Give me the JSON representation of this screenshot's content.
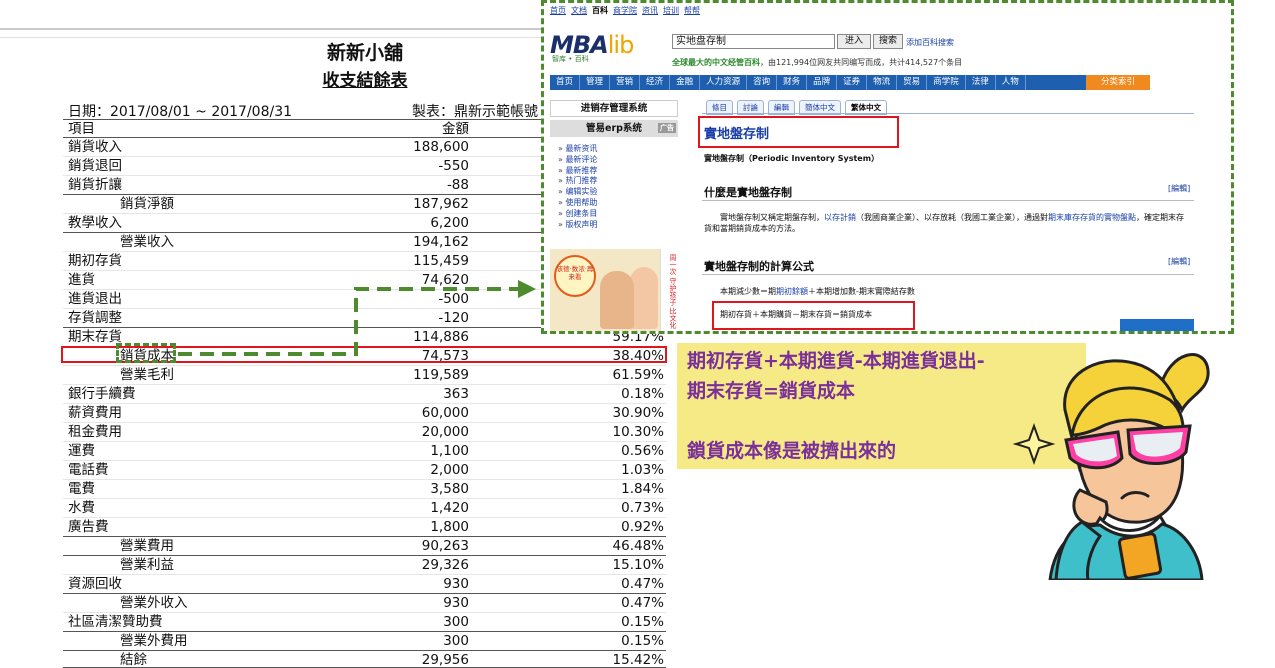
{
  "report": {
    "company": "新新小舖",
    "title": "收支結餘表",
    "date_range": "日期：2017/08/01 ~ 2017/08/31",
    "maker": "製表：鼎新示範帳號 ",
    "header": {
      "item": "項目",
      "amount": "金額",
      "pct": ""
    },
    "rows": [
      {
        "label": "銷貨收入",
        "amount": "188,600",
        "pct": "",
        "indent": false
      },
      {
        "label": "銷貨退回",
        "amount": "-550",
        "pct": "",
        "indent": false
      },
      {
        "label": "銷貨折讓",
        "amount": "-88",
        "pct": "",
        "indent": false
      },
      {
        "label": "銷貨淨額",
        "amount": "187,962",
        "pct": "",
        "indent": true
      },
      {
        "label": "教學收入",
        "amount": "6,200",
        "pct": "",
        "indent": false
      },
      {
        "label": "營業收入",
        "amount": "194,162",
        "pct": "",
        "indent": true
      },
      {
        "label": "期初存貨",
        "amount": "115,459",
        "pct": "",
        "indent": false
      },
      {
        "label": "進貨",
        "amount": "74,620",
        "pct": "",
        "indent": false
      },
      {
        "label": "進貨退出",
        "amount": "-500",
        "pct": "",
        "indent": false
      },
      {
        "label": "存貨調整",
        "amount": "-120",
        "pct": "",
        "indent": false
      },
      {
        "label": "期末存貨",
        "amount": "114,886",
        "pct": "59.17%",
        "indent": false
      },
      {
        "label": "銷貨成本",
        "amount": "74,573",
        "pct": "38.40%",
        "indent": true
      },
      {
        "label": "營業毛利",
        "amount": "119,589",
        "pct": "61.59%",
        "indent": true
      },
      {
        "label": "銀行手續費",
        "amount": "363",
        "pct": "0.18%",
        "indent": false
      },
      {
        "label": "薪資費用",
        "amount": "60,000",
        "pct": "30.90%",
        "indent": false
      },
      {
        "label": "租金費用",
        "amount": "20,000",
        "pct": "10.30%",
        "indent": false
      },
      {
        "label": "運費",
        "amount": "1,100",
        "pct": "0.56%",
        "indent": false
      },
      {
        "label": "電話費",
        "amount": "2,000",
        "pct": "1.03%",
        "indent": false
      },
      {
        "label": "電費",
        "amount": "3,580",
        "pct": "1.84%",
        "indent": false
      },
      {
        "label": "水費",
        "amount": "1,420",
        "pct": "0.73%",
        "indent": false
      },
      {
        "label": "廣告費",
        "amount": "1,800",
        "pct": "0.92%",
        "indent": false
      },
      {
        "label": "營業費用",
        "amount": "90,263",
        "pct": "46.48%",
        "indent": true
      },
      {
        "label": "營業利益",
        "amount": "29,326",
        "pct": "15.10%",
        "indent": true
      },
      {
        "label": "資源回收",
        "amount": "930",
        "pct": "0.47%",
        "indent": false
      },
      {
        "label": "營業外收入",
        "amount": "930",
        "pct": "0.47%",
        "indent": true
      },
      {
        "label": "社區清潔贊助費",
        "amount": "300",
        "pct": "0.15%",
        "indent": false
      },
      {
        "label": "營業外費用",
        "amount": "300",
        "pct": "0.15%",
        "indent": true
      },
      {
        "label": "結餘",
        "amount": "29,956",
        "pct": "15.42%",
        "indent": true
      }
    ]
  },
  "browser": {
    "topnav": [
      "首页",
      "文档",
      "百科",
      "商学院",
      "资讯",
      "培训",
      "帮帮"
    ],
    "topnav_current": "百科",
    "logo": {
      "main": "MBA",
      "accent": "lib",
      "sub": "智库 • 百科"
    },
    "search_value": "实地盘存制",
    "search_btn_in": "进入",
    "search_btn_search": "搜索",
    "add_link": "添加百科搜索",
    "slogan_prefix": "全球最大的中文经管百科",
    "slogan_rest": "，由121,994位网友共同编写而成，共计414,527个条目",
    "menu": [
      "首页",
      "管理",
      "营销",
      "经济",
      "金融",
      "人力资源",
      "咨询",
      "财务",
      "品牌",
      "证券",
      "物流",
      "贸易",
      "商学院",
      "法律",
      "人物"
    ],
    "menu_special": "分类索引",
    "side_box1": "进销存管理系统",
    "side_box2": "管易erp系统",
    "ad_tag": "广告",
    "side_links": [
      "最新资讯",
      "最新评论",
      "最新推荐",
      "热门推荐",
      "编辑实验",
      "使用帮助",
      "创建条目",
      "版权声明"
    ],
    "ad_text": "该德·数浓·再来看",
    "ad_strip": "周一次 守护孩子 比文化",
    "tabs": [
      "條目",
      "討論",
      "編輯",
      "簡体中文",
      "繁体中文"
    ],
    "tab_current": "繁体中文",
    "article_title": "實地盤存制",
    "article_en": "實地盤存制（Periodic Inventory System）",
    "section1": "什麼是實地盤存制",
    "edit_label": "[編輯]",
    "para_a": "　　實地盤存制又稱定期盤存制，",
    "para_link1": "以存計銷",
    "para_b": "（我國商業企業）、以存放耗（我國工業企業），通過對",
    "para_link2": "期末庫存存貨的實物盤點",
    "para_c": "，確定期末存貨和當期銷貨成本的方法。",
    "section2": "實地盤存制的計算公式",
    "formula1_a": "本期減少數＝期",
    "formula1_link": "期初餘額",
    "formula1_b": "＋本期增加數-期末實際結存數",
    "formula2": "期初存貨＋本期購貨－期末存貨＝銷貨成本"
  },
  "callout": {
    "line1": "期初存貨+本期進貨-本期進貨退出-",
    "line2": "期末存貨=銷貨成本",
    "line3": "",
    "line4": "鎖貨成本像是被擠出來的"
  },
  "colors": {
    "highlight_red": "#e0161e",
    "dash_green": "#4e8a2e",
    "callout_bg": "#f5ea86",
    "callout_text": "#7a2f9a",
    "menu_blue": "#1f5fb0"
  }
}
